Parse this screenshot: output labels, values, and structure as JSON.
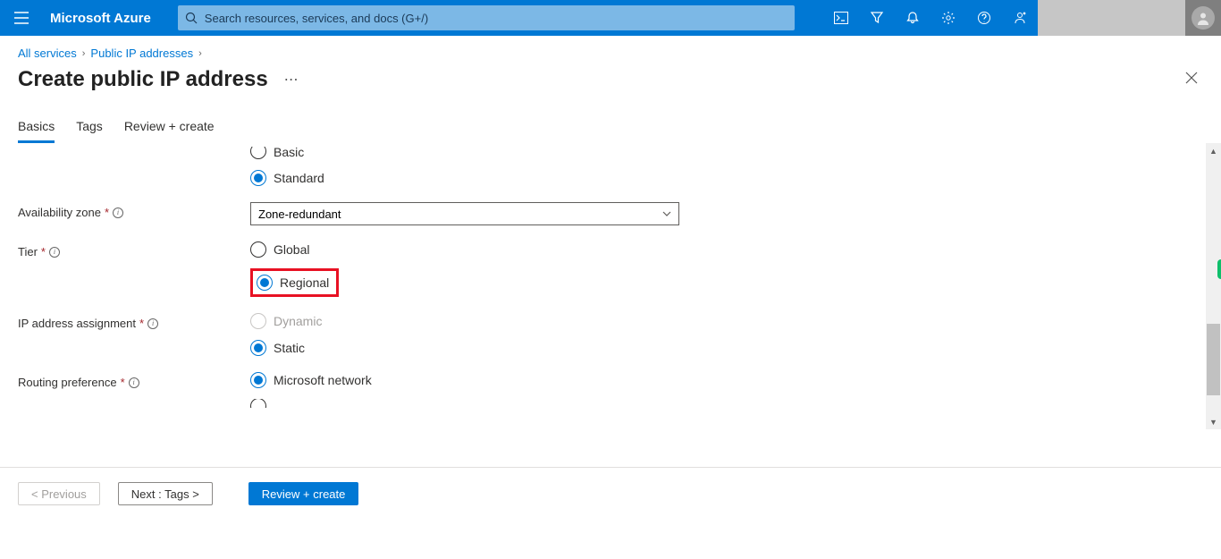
{
  "header": {
    "brand": "Microsoft Azure",
    "search_placeholder": "Search resources, services, and docs (G+/)"
  },
  "breadcrumb": {
    "root": "All services",
    "second": "Public IP addresses"
  },
  "page": {
    "title": "Create public IP address"
  },
  "tabs": {
    "basics": "Basics",
    "tags": "Tags",
    "review": "Review + create"
  },
  "form": {
    "sku": {
      "basic_label": "Basic",
      "standard_label": "Standard"
    },
    "availability_zone": {
      "label": "Availability zone",
      "value": "Zone-redundant"
    },
    "tier": {
      "label": "Tier",
      "global_label": "Global",
      "regional_label": "Regional"
    },
    "ip_assignment": {
      "label": "IP address assignment",
      "dynamic_label": "Dynamic",
      "static_label": "Static"
    },
    "routing": {
      "label": "Routing preference",
      "ms_network_label": "Microsoft network"
    }
  },
  "footer": {
    "previous": "< Previous",
    "next": "Next : Tags >",
    "review": "Review + create"
  }
}
